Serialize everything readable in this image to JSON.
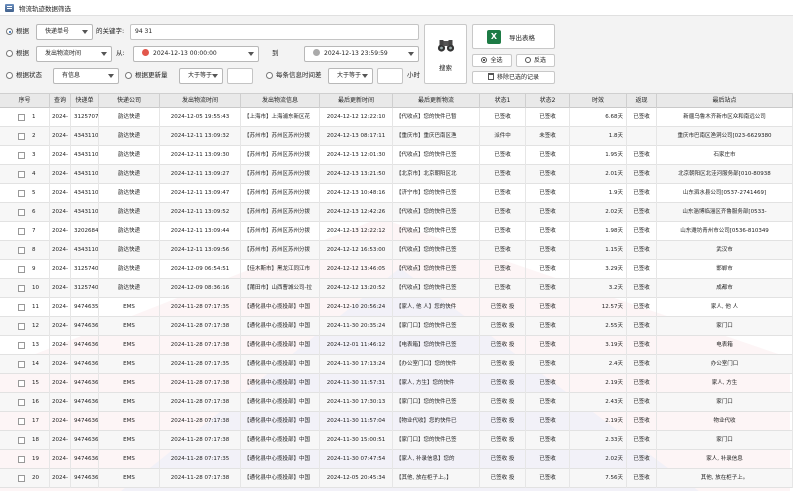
{
  "window": {
    "title": "物流轨迹数据筛选"
  },
  "filters": {
    "row1": {
      "radio_label": "根据",
      "field_value": "快递单号",
      "keyword_label": "的关键字:",
      "keyword_value": "94 31"
    },
    "row2": {
      "radio_label": "根据",
      "field_value": "发出物流时间",
      "from_label": "从:",
      "from_value": "2024-12-13 00:00:00",
      "to_label": "到",
      "to_value": "2024-12-13 23:59:59"
    },
    "row3": {
      "radio_label": "根据状态",
      "status_value": "有信息",
      "count_radio_label": "根据更新量",
      "count_op": "大于等于",
      "count_value": "",
      "interval_radio_label": "每条信息时间差",
      "interval_op": "大于等于",
      "interval_value": "",
      "interval_unit": "小时"
    }
  },
  "buttons": {
    "search": "搜索",
    "export": "导出表格",
    "select_all": "全选",
    "invert": "反选",
    "remove_selected": "移除已选的记录"
  },
  "table": {
    "columns": [
      "序号",
      "查询",
      "快递单",
      "快递公司",
      "发出物流时间",
      "发出物流信息",
      "最后更新时间",
      "最后更新物流",
      "状态1",
      "状态2",
      "时效",
      "返现",
      "最后站点"
    ],
    "rows": [
      {
        "no": "1",
        "q": "2024-",
        "waybill": "3125707",
        "company": "韵达快递",
        "send_time": "2024-12-05 19:55:43",
        "send_info": "【上海市】上海浦东新区花",
        "update_time": "2024-12-12 12:22:10",
        "update_info": "【代收点】您的快件已暂",
        "s1": "已签收",
        "s2": "已签收",
        "eff": "6.68天",
        "ret": "已签收",
        "last": "新疆乌鲁木齐新市区众和南远公司"
      },
      {
        "no": "2",
        "q": "2024-",
        "waybill": "4343110",
        "company": "韵达快递",
        "send_time": "2024-12-11 13:09:32",
        "send_info": "【苏州市】苏州区苏州分拨",
        "update_time": "2024-12-13 08:17:11",
        "update_info": "【重庆市】重庆巴南区渔",
        "s1": "派件中",
        "s2": "未签收",
        "eff": "1.8天",
        "ret": "",
        "last": "重庆市巴南区渔洞公司[023-6629380"
      },
      {
        "no": "3",
        "q": "2024-",
        "waybill": "4343110",
        "company": "韵达快递",
        "send_time": "2024-12-11 13:09:30",
        "send_info": "【苏州市】苏州区苏州分拨",
        "update_time": "2024-12-13 12:01:30",
        "update_info": "【代收点】您的快件已签",
        "s1": "已签收",
        "s2": "已签收",
        "eff": "1.95天",
        "ret": "已签收",
        "last": "石家庄市"
      },
      {
        "no": "4",
        "q": "2024-",
        "waybill": "4343110",
        "company": "韵达快递",
        "send_time": "2024-12-11 13:09:27",
        "send_info": "【苏州市】苏州区苏州分拨",
        "update_time": "2024-12-13 13:21:50",
        "update_info": "【北京市】北京朝阳区北",
        "s1": "已签收",
        "s2": "已签收",
        "eff": "2.01天",
        "ret": "已签收",
        "last": "北京朝阳区北洼河服务部[010-80938"
      },
      {
        "no": "5",
        "q": "2024-",
        "waybill": "4343110",
        "company": "韵达快递",
        "send_time": "2024-12-11 13:09:47",
        "send_info": "【苏州市】苏州区苏州分拨",
        "update_time": "2024-12-13 10:48:16",
        "update_info": "【济宁市】您的快件已签",
        "s1": "已签收",
        "s2": "已签收",
        "eff": "1.9天",
        "ret": "已签收",
        "last": "山东泗水县公司[0537-2741469]"
      },
      {
        "no": "6",
        "q": "2024-",
        "waybill": "4343110",
        "company": "韵达快递",
        "send_time": "2024-12-11 13:09:52",
        "send_info": "【苏州市】苏州区苏州分拨",
        "update_time": "2024-12-13 12:42:26",
        "update_info": "【代收点】您的快件已签",
        "s1": "已签收",
        "s2": "已签收",
        "eff": "2.02天",
        "ret": "已签收",
        "last": "山东淄博临淄区齐鲁服务部[0533-"
      },
      {
        "no": "7",
        "q": "2024-",
        "waybill": "3202684",
        "company": "韵达快递",
        "send_time": "2024-12-11 13:09:44",
        "send_info": "【苏州市】苏州区苏州分拨",
        "update_time": "2024-12-13 12:22:12",
        "update_info": "【代收点】您的快件已签",
        "s1": "已签收",
        "s2": "已签收",
        "eff": "1.98天",
        "ret": "已签收",
        "last": "山东潍坊青州市公司[0536-810349"
      },
      {
        "no": "8",
        "q": "2024-",
        "waybill": "4343110",
        "company": "韵达快递",
        "send_time": "2024-12-11 13:09:56",
        "send_info": "【苏州市】苏州区苏州分拨",
        "update_time": "2024-12-12 16:53:00",
        "update_info": "【代收点】您的快件已签",
        "s1": "已签收",
        "s2": "已签收",
        "eff": "1.15天",
        "ret": "已签收",
        "last": "武汉市"
      },
      {
        "no": "9",
        "q": "2024-",
        "waybill": "3125740",
        "company": "韵达快递",
        "send_time": "2024-12-09 06:54:51",
        "send_info": "【佳木斯市】黑龙江同江市",
        "update_time": "2024-12-12 13:46:05",
        "update_info": "【代收点】您的快件已签",
        "s1": "已签收",
        "s2": "已签收",
        "eff": "3.29天",
        "ret": "已签收",
        "last": "邯郸市"
      },
      {
        "no": "10",
        "q": "2024-",
        "waybill": "3125740",
        "company": "韵达快递",
        "send_time": "2024-12-09 08:36:16",
        "send_info": "【莆田市】山西曹城公司-拉",
        "update_time": "2024-12-12 13:20:52",
        "update_info": "【代收点】您的快件已签",
        "s1": "已签收",
        "s2": "已签收",
        "eff": "3.2天",
        "ret": "已签收",
        "last": "成都市"
      },
      {
        "no": "11",
        "q": "2024-",
        "waybill": "9474635",
        "company": "EMS",
        "send_time": "2024-11-28 07:17:35",
        "send_info": "【通化县中心揽投部】中国",
        "update_time": "2024-12-10 20:56:24",
        "update_info": "【家人, 他 人】您的快件",
        "s1": "已签收 投",
        "s2": "已签收",
        "eff": "12.57天",
        "ret": "已签收",
        "last": "家人, 他 人"
      },
      {
        "no": "12",
        "q": "2024-",
        "waybill": "9474636",
        "company": "EMS",
        "send_time": "2024-11-28 07:17:38",
        "send_info": "【通化县中心揽投部】中国",
        "update_time": "2024-11-30 20:35:24",
        "update_info": "【家门口】您的快件已签",
        "s1": "已签收 投",
        "s2": "已签收",
        "eff": "2.55天",
        "ret": "已签收",
        "last": "家门口"
      },
      {
        "no": "13",
        "q": "2024-",
        "waybill": "9474636",
        "company": "EMS",
        "send_time": "2024-11-28 07:17:38",
        "send_info": "【通化县中心揽投部】中国",
        "update_time": "2024-12-01 11:46:12",
        "update_info": "【电表箱】您的快件已签",
        "s1": "已签收 投",
        "s2": "已签收",
        "eff": "3.19天",
        "ret": "已签收",
        "last": "电表箱"
      },
      {
        "no": "14",
        "q": "2024-",
        "waybill": "9474636",
        "company": "EMS",
        "send_time": "2024-11-28 07:17:35",
        "send_info": "【通化县中心揽投部】中国",
        "update_time": "2024-11-30 17:13:24",
        "update_info": "【办公室门口】您的快件",
        "s1": "已签收 投",
        "s2": "已签收",
        "eff": "2.4天",
        "ret": "已签收",
        "last": "办公室门口"
      },
      {
        "no": "15",
        "q": "2024-",
        "waybill": "9474636",
        "company": "EMS",
        "send_time": "2024-11-28 07:17:38",
        "send_info": "【通化县中心揽投部】中国",
        "update_time": "2024-11-30 11:57:31",
        "update_info": "【家人, 方生】您的快件",
        "s1": "已签收 投",
        "s2": "已签收",
        "eff": "2.19天",
        "ret": "已签收",
        "last": "家人, 方生"
      },
      {
        "no": "16",
        "q": "2024-",
        "waybill": "9474636",
        "company": "EMS",
        "send_time": "2024-11-28 07:17:38",
        "send_info": "【通化县中心揽投部】中国",
        "update_time": "2024-11-30 17:30:13",
        "update_info": "【家门口】您的快件已签",
        "s1": "已签收 投",
        "s2": "已签收",
        "eff": "2.43天",
        "ret": "已签收",
        "last": "家门口"
      },
      {
        "no": "17",
        "q": "2024-",
        "waybill": "9474636",
        "company": "EMS",
        "send_time": "2024-11-28 07:17:38",
        "send_info": "【通化县中心揽投部】中国",
        "update_time": "2024-11-30 11:57:04",
        "update_info": "【物业代收】您的快件已",
        "s1": "已签收 投",
        "s2": "已签收",
        "eff": "2.19天",
        "ret": "已签收",
        "last": "物业代收"
      },
      {
        "no": "18",
        "q": "2024-",
        "waybill": "9474636",
        "company": "EMS",
        "send_time": "2024-11-28 07:17:38",
        "send_info": "【通化县中心揽投部】中国",
        "update_time": "2024-11-30 15:00:51",
        "update_info": "【家门口】您的快件已签",
        "s1": "已签收 投",
        "s2": "已签收",
        "eff": "2.33天",
        "ret": "已签收",
        "last": "家门口"
      },
      {
        "no": "19",
        "q": "2024-",
        "waybill": "9474636",
        "company": "EMS",
        "send_time": "2024-11-28 07:17:35",
        "send_info": "【通化县中心揽投部】中国",
        "update_time": "2024-11-30 07:47:54",
        "update_info": "【家人, 补录信息】您的",
        "s1": "已签收 投",
        "s2": "已签收",
        "eff": "2.02天",
        "ret": "已签收",
        "last": "家人, 补录信息"
      },
      {
        "no": "20",
        "q": "2024-",
        "waybill": "9474636",
        "company": "EMS",
        "send_time": "2024-11-28 07:17:38",
        "send_info": "【通化县中心揽投部】中国",
        "update_time": "2024-12-05 20:45:34",
        "update_info": "【其他, 放在柜子上。】",
        "s1": "已签收 投",
        "s2": "已签收",
        "eff": "7.56天",
        "ret": "已签收",
        "last": "其他, 放在柜子上。"
      }
    ]
  },
  "colors": {
    "accent": "#1e5fb0",
    "excel": "#1d7b45",
    "calendar_red": "#e2574c"
  }
}
